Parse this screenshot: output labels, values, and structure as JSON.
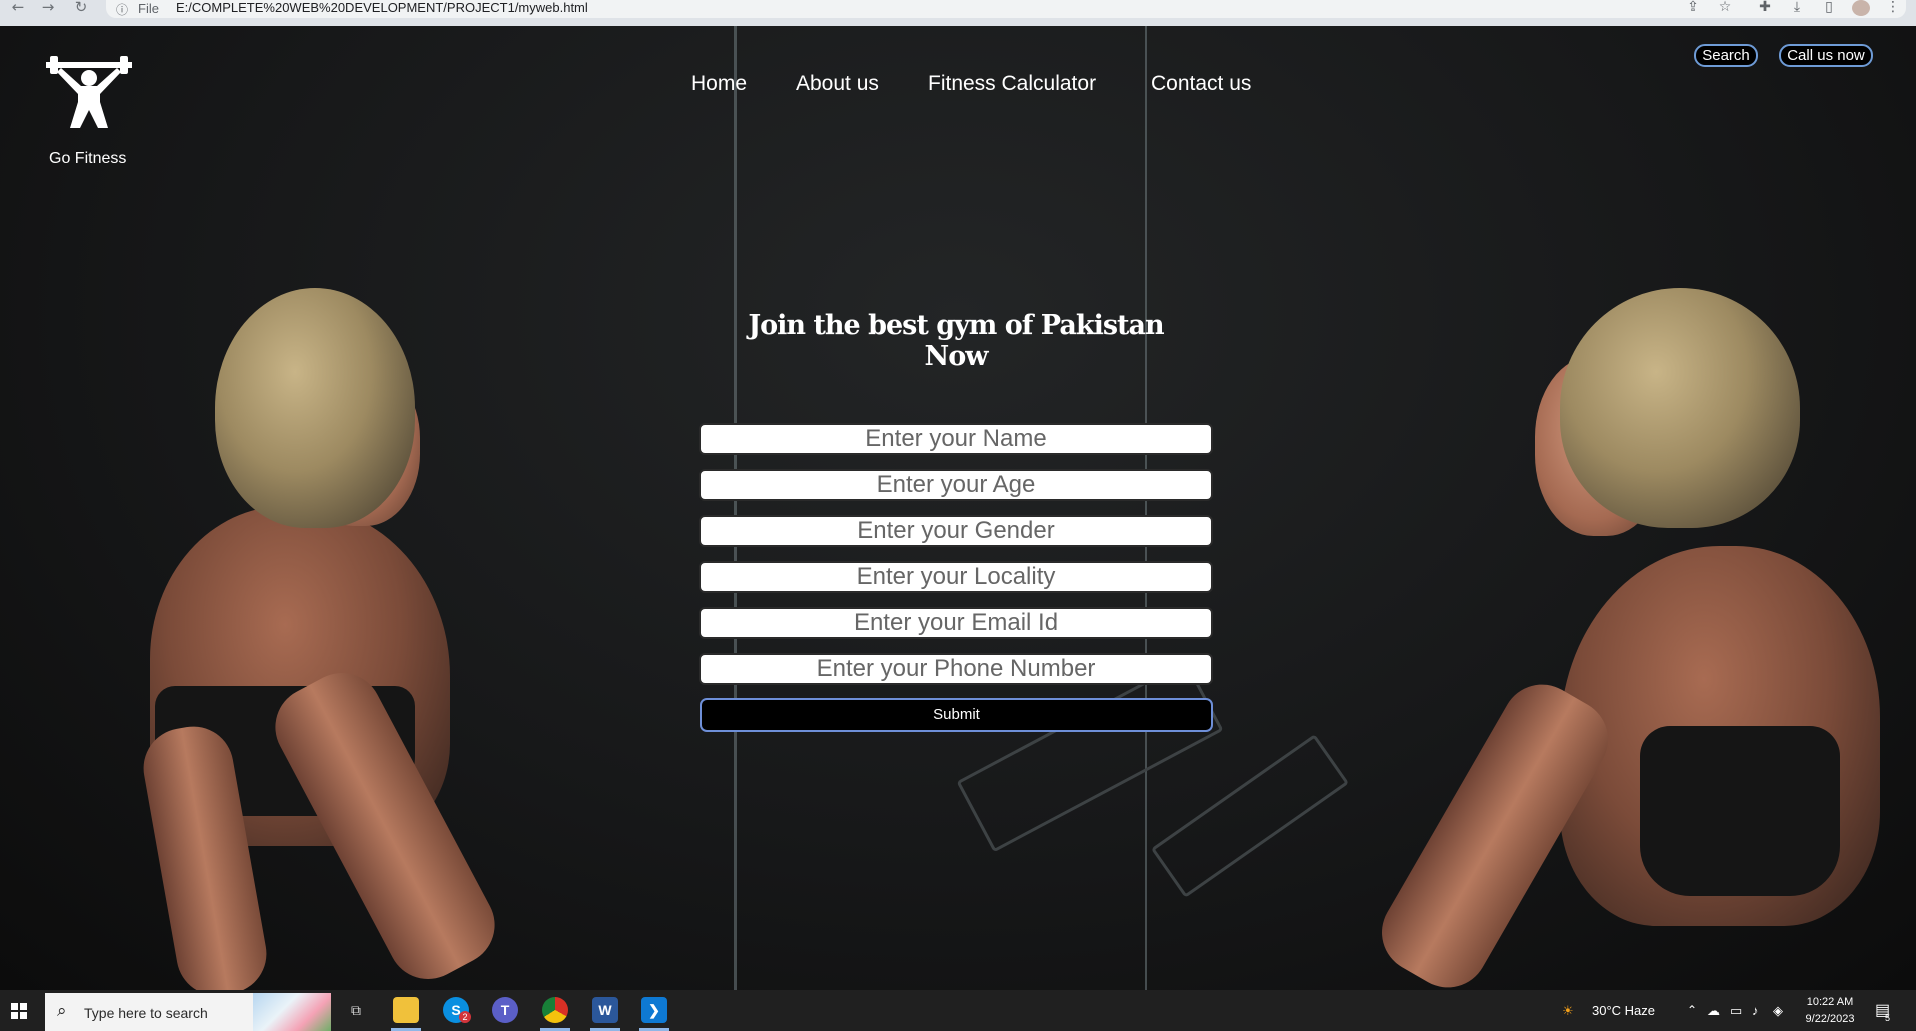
{
  "browser": {
    "info_glyph": "ⓘ",
    "scheme_label": "File",
    "url": "E:/COMPLETE%20WEB%20DEVELOPMENT/PROJECT1/myweb.html"
  },
  "site": {
    "brand": "Go Fitness",
    "nav": [
      "Home",
      "About us",
      "Fitness Calculator",
      "Contact us"
    ],
    "search_button": "Search",
    "call_button": "Call us now"
  },
  "form": {
    "headline": "Join the best gym of Pakistan Now",
    "fields": [
      {
        "placeholder": "Enter your Name"
      },
      {
        "placeholder": "Enter your Age"
      },
      {
        "placeholder": "Enter your Gender"
      },
      {
        "placeholder": "Enter your Locality"
      },
      {
        "placeholder": "Enter your Email Id"
      },
      {
        "placeholder": "Enter your Phone Number"
      }
    ],
    "submit": "Submit"
  },
  "taskbar": {
    "search_placeholder": "Type here to search",
    "weather": "30°C  Haze",
    "time": "10:22 AM",
    "date": "9/22/2023",
    "notification_count": "5",
    "skype_badge": "2"
  }
}
